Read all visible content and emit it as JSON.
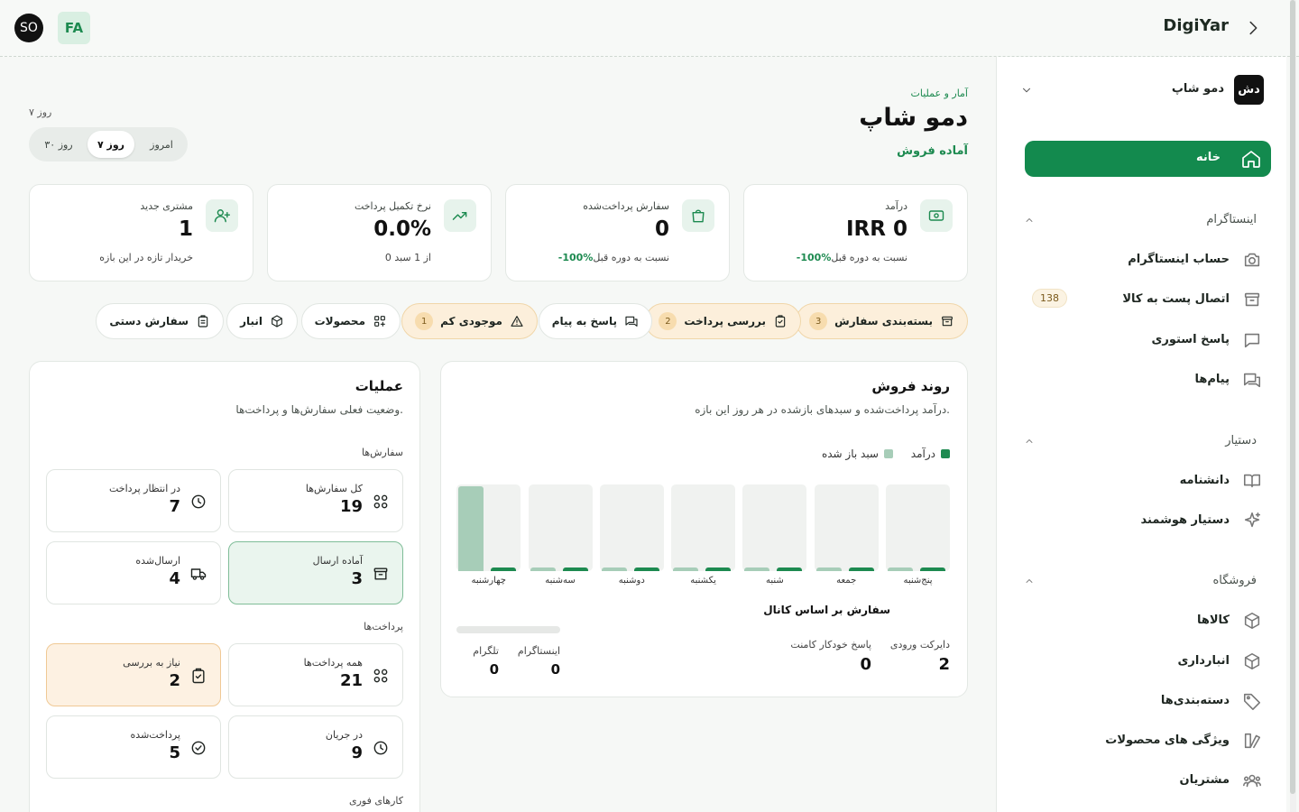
{
  "topbar": {
    "brand": "DigiYar",
    "avatar": "SO",
    "language": "FA"
  },
  "sidebar": {
    "shop": {
      "logo": "دش",
      "name": "دمو شاپ"
    },
    "home": "خانه",
    "sections": [
      {
        "title": "اینستاگرام",
        "items": [
          {
            "label": "حساب اینستاگرام",
            "icon": "camera-icon"
          },
          {
            "label": "اتصال پست به کالا",
            "icon": "archive-icon",
            "badge": "138"
          },
          {
            "label": "پاسخ استوری",
            "icon": "chat-icon"
          },
          {
            "label": "پیام‌ها",
            "icon": "messages-icon"
          }
        ]
      },
      {
        "title": "دستیار",
        "items": [
          {
            "label": "دانشنامه",
            "icon": "book-icon"
          },
          {
            "label": "دستیار هوشمند",
            "icon": "sparkles-icon"
          }
        ]
      },
      {
        "title": "فروشگاه",
        "items": [
          {
            "label": "کالاها",
            "icon": "box-icon"
          },
          {
            "label": "انبارداری",
            "icon": "box-icon"
          },
          {
            "label": "دسته‌بندی‌ها",
            "icon": "tag-icon"
          },
          {
            "label": "ویژگی های محصولات",
            "icon": "attributes-icon"
          },
          {
            "label": "مشتریان",
            "icon": "users-icon"
          }
        ]
      }
    ]
  },
  "header": {
    "breadcrumb": "آمار و عملیات",
    "title": "دمو شاپ",
    "status": "آماده فروش",
    "range_label": "۷ روز",
    "range_options": [
      "امروز",
      "۷ روز",
      "۳۰ روز"
    ],
    "range_selected": "۷ روز"
  },
  "kpis": [
    {
      "title": "درآمد",
      "value": "IRR 0",
      "pct": "-100%",
      "note": "نسبت به دوره قبل",
      "icon": "money-icon"
    },
    {
      "title": "سفارش پرداخت‌شده",
      "value": "0",
      "pct": "-100%",
      "note": "نسبت به دوره قبل",
      "icon": "bag-icon"
    },
    {
      "title": "نرخ تکمیل پرداخت",
      "value": "0.0%",
      "pct": "",
      "note": "0 از 1 سبد",
      "icon": "trend-icon"
    },
    {
      "title": "مشتری جدید",
      "value": "1",
      "pct": "",
      "note": "خریدار تازه در این بازه",
      "icon": "user-plus-icon"
    }
  ],
  "quick_actions": [
    {
      "label": "بسته‌بندی سفارش",
      "count": "3",
      "warn": true,
      "icon": "archive-icon"
    },
    {
      "label": "بررسی پرداخت",
      "count": "2",
      "warn": true,
      "icon": "clipboard-icon"
    },
    {
      "label": "پاسخ به پیام",
      "count": "",
      "warn": false,
      "icon": "messages-icon"
    },
    {
      "label": "موجودی کم",
      "count": "1",
      "warn": true,
      "icon": "alert-icon"
    },
    {
      "label": "محصولات",
      "count": "",
      "warn": false,
      "icon": "grid-plus-icon"
    },
    {
      "label": "انبار",
      "count": "",
      "warn": false,
      "icon": "box-icon"
    },
    {
      "label": "سفارش دستی",
      "count": "",
      "warn": false,
      "icon": "clipboard-icon"
    }
  ],
  "sales_trend": {
    "title": "روند فروش",
    "subtitle": "درآمد پرداخت‌شده و سبدهای بازشده در هر روز این بازه.",
    "legend_revenue": "درآمد",
    "legend_cart": "سبد باز شده",
    "channel_title": "سفارش بر اساس کانال",
    "channels": [
      {
        "label": "دایرکت ورودی",
        "value": "2"
      },
      {
        "label": "پاسخ خودکار کامنت",
        "value": "0"
      },
      {
        "label": "اینستاگرام",
        "value": "0"
      },
      {
        "label": "تلگرام",
        "value": "0"
      }
    ]
  },
  "chart_data": {
    "type": "bar",
    "categories": [
      "پنج‌شنبه",
      "جمعه",
      "شنبه",
      "یکشنبه",
      "دوشنبه",
      "سه‌شنبه",
      "چهارشنبه"
    ],
    "series": [
      {
        "name": "درآمد",
        "values": [
          0,
          0,
          0,
          0,
          0,
          0,
          0
        ]
      },
      {
        "name": "سبد باز شده",
        "values": [
          0,
          0,
          0,
          0,
          0,
          0,
          1
        ]
      }
    ],
    "ylim": [
      0,
      1
    ],
    "colors": {
      "revenue": "#1d8a50",
      "cart": "#a7cdb8"
    }
  },
  "operations": {
    "title": "عملیات",
    "subtitle": "وضعیت فعلی سفارش‌ها و پرداخت‌ها.",
    "orders_title": "سفارش‌ها",
    "orders": [
      {
        "label": "کل سفارش‌ها",
        "value": "19",
        "icon": "grid-icon",
        "style": "plain"
      },
      {
        "label": "در انتظار پرداخت",
        "value": "7",
        "icon": "clock-icon",
        "style": "plain"
      },
      {
        "label": "آماده ارسال",
        "value": "3",
        "icon": "archive-icon",
        "style": "green"
      },
      {
        "label": "ارسال‌شده",
        "value": "4",
        "icon": "truck-icon",
        "style": "plain"
      }
    ],
    "payments_title": "پرداخت‌ها",
    "payments": [
      {
        "label": "همه پرداخت‌ها",
        "value": "21",
        "icon": "grid-icon",
        "style": "plain"
      },
      {
        "label": "نیاز به بررسی",
        "value": "2",
        "icon": "clipboard-icon",
        "style": "orange"
      },
      {
        "label": "در جریان",
        "value": "9",
        "icon": "clock-icon",
        "style": "plain"
      },
      {
        "label": "پرداخت‌شده",
        "value": "5",
        "icon": "check-icon",
        "style": "plain"
      }
    ],
    "urgent_title": "کارهای فوری"
  },
  "colors": {
    "primary": "#138a4e",
    "warn_bg": "#fcefdb"
  }
}
